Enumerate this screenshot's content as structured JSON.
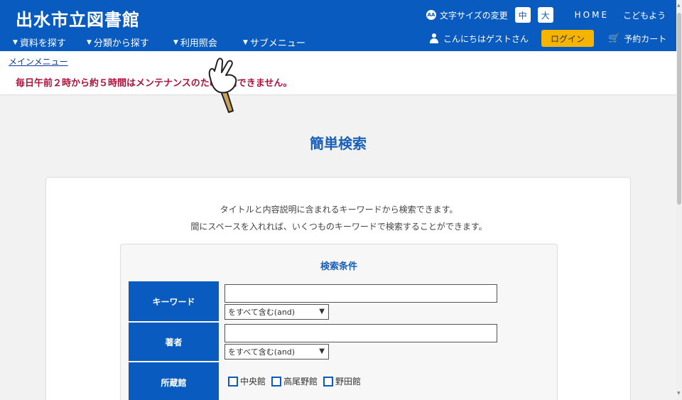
{
  "header": {
    "site_title": "出水市立図書館",
    "nav": [
      {
        "label": "資料を探す"
      },
      {
        "label": "分類から探す"
      },
      {
        "label": "利用照会"
      },
      {
        "label": "サブメニュー"
      }
    ],
    "text_size_label": "文字サイズの変更",
    "size_medium": "中",
    "size_large": "大",
    "home": "HOME",
    "kids": "こどもよう",
    "greeting": "こんにちはゲストさん",
    "login": "ログイン",
    "cart": "予約カート"
  },
  "breadcrumb": "メインメニュー",
  "notice": "毎日午前２時から約５時間はメンテナンスのため利用できません。",
  "main": {
    "title": "簡単検索",
    "desc1": "タイトルと内容説明に含まれるキーワードから検索できます。",
    "desc2": "間にスペースを入れれば、いくつものキーワードで検索することができます。",
    "criteria_title": "検索条件",
    "rows": [
      {
        "label": "キーワード",
        "value": "",
        "mode": "をすべて含む(and)"
      },
      {
        "label": "著者",
        "value": "",
        "mode": "をすべて含む(and)"
      },
      {
        "label": "所蔵館"
      }
    ],
    "libraries": [
      "中央館",
      "高尾野館",
      "野田館"
    ]
  },
  "colors": {
    "primary": "#0a5bbf",
    "accent": "#f5b400",
    "notice": "#b0103a"
  }
}
